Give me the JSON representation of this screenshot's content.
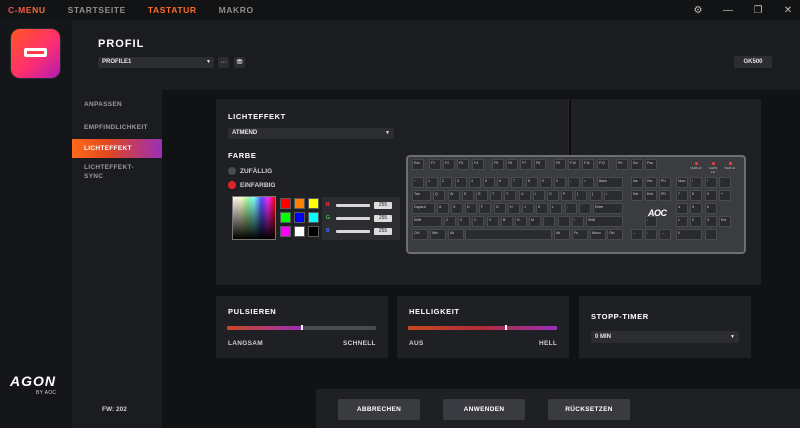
{
  "topnav": {
    "cmenu": "C-MENU",
    "startseite": "STARTSEITE",
    "tastatur": "TASTATUR",
    "makro": "MAKRO"
  },
  "window": {
    "settings_icon": "gear-icon",
    "minimize_icon": "minimize-icon",
    "restore_icon": "restore-icon",
    "close_icon": "close-icon"
  },
  "brand": {
    "agon": "AGON",
    "by": "BY AOC",
    "tile_icon": "keyboard-icon"
  },
  "header": {
    "title": "PROFIL",
    "profile_value": "PROFILE1",
    "more_label": "···",
    "model": "GK500"
  },
  "subnav": {
    "items": [
      "ANPASSEN",
      "EMPFINDLICHKEIT",
      "LICHTEFFEKT",
      "LICHTEFFEKT-\nSYNC"
    ],
    "active_index": 2,
    "fw": "FW: 202"
  },
  "lighting": {
    "title": "LICHTEFFEKT",
    "effect_value": "ATMEND",
    "color_title": "FARBE",
    "random_label": "ZUFÄLLIG",
    "single_label": "EINFARBIG",
    "swatches": [
      "#ff0000",
      "#ff8000",
      "#ffff00",
      "#00ff00",
      "#0000ff",
      "#00ffff",
      "#ff00ff",
      "#ffffff",
      "#000000"
    ],
    "rgb": [
      {
        "channel": "R",
        "value": "255",
        "color": "#ff3a3a"
      },
      {
        "channel": "G",
        "value": "255",
        "color": "#3ad13a"
      },
      {
        "channel": "B",
        "value": "255",
        "color": "#3a6bff"
      }
    ]
  },
  "keyboard": {
    "brand": "AOC",
    "indicators": [
      "NUM LK",
      "CAPS LK",
      "SCR LK"
    ],
    "rows": [
      [
        "Esc",
        "F1",
        "F2",
        "F3",
        "F4",
        "F5",
        "F6",
        "F7",
        "F8",
        "F9",
        "F10",
        "F11",
        "F12",
        "Prt",
        "Scr",
        "Pau"
      ],
      [
        "~",
        "1",
        "2",
        "3",
        "4",
        "5",
        "6",
        "7",
        "8",
        "9",
        "0",
        "-",
        "=",
        "Back",
        "Ins",
        "Hm",
        "PU",
        "Num",
        "/",
        "*",
        "-"
      ],
      [
        "Tab",
        "Q",
        "W",
        "E",
        "R",
        "T",
        "Y",
        "U",
        "I",
        "O",
        "P",
        "[",
        "]",
        "\\",
        "Del",
        "End",
        "PD",
        "7",
        "8",
        "9",
        "+"
      ],
      [
        "CapsLk",
        "A",
        "S",
        "D",
        "F",
        "G",
        "H",
        "J",
        "K",
        "L",
        ";",
        "'",
        "Enter",
        "4",
        "5",
        "6"
      ],
      [
        "Shift",
        "Z",
        "X",
        "C",
        "V",
        "B",
        "N",
        "M",
        ",",
        ".",
        "/",
        "Shift",
        "↑",
        "1",
        "2",
        "3",
        "Ent"
      ],
      [
        "Ctrl",
        "Win",
        "Alt",
        "",
        "Alt",
        "Fn",
        "Menu",
        "Ctrl",
        "←",
        "↓",
        "→",
        "0",
        "."
      ]
    ]
  },
  "pulse": {
    "title": "PULSIEREN",
    "min_label": "LANGSAM",
    "max_label": "SCHNELL",
    "value": 0.5
  },
  "brightness": {
    "title": "HELLIGKEIT",
    "min_label": "AUS",
    "max_label": "HELL",
    "value": 0.66
  },
  "timer": {
    "title": "STOPP-TIMER",
    "value": "0 MIN"
  },
  "actions": {
    "cancel": "ABBRECHEN",
    "apply": "ANWENDEN",
    "reset": "RÜCKSETZEN"
  },
  "colors": {
    "accent": "#ff6a2a",
    "accent_purple": "#9b2fb8"
  }
}
